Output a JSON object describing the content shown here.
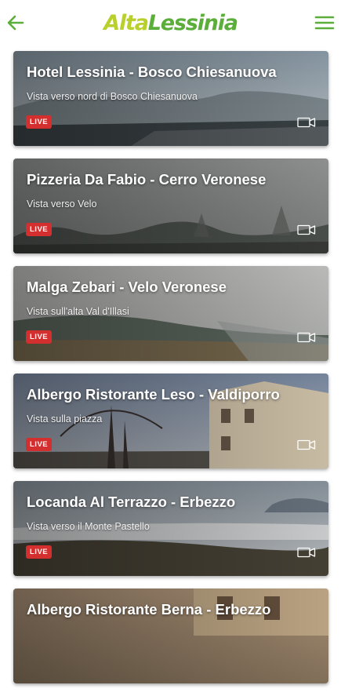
{
  "header": {
    "logo_part1": "Alta",
    "logo_part2": "Lessinia",
    "back_icon": "arrow-left-icon",
    "menu_icon": "hamburger-menu-icon",
    "accent": "#5cae3a"
  },
  "webcams": [
    {
      "title": "Hotel Lessinia - Bosco Chiesanuova",
      "subtitle": "Vista verso nord di Bosco Chiesanuova",
      "badge": "LIVE",
      "icon": "video-camera-icon"
    },
    {
      "title": "Pizzeria Da Fabio - Cerro Veronese",
      "subtitle": "Vista verso Velo",
      "badge": "LIVE",
      "icon": "video-camera-icon"
    },
    {
      "title": "Malga Zebari - Velo Veronese",
      "subtitle": "Vista sull'alta Val d'Illasi",
      "badge": "LIVE",
      "icon": "video-camera-icon"
    },
    {
      "title": "Albergo Ristorante Leso - Valdiporro",
      "subtitle": "Vista sulla piazza",
      "badge": "LIVE",
      "icon": "video-camera-icon"
    },
    {
      "title": "Locanda Al Terrazzo - Erbezzo",
      "subtitle": "Vista verso il Monte Pastello",
      "badge": "LIVE",
      "icon": "video-camera-icon"
    },
    {
      "title": "Albergo Ristorante Berna - Erbezzo",
      "subtitle": "",
      "badge": "",
      "icon": "video-camera-icon"
    }
  ],
  "colors": {
    "live_badge": "#d32f2f",
    "logo_light": "#b8cf2c",
    "logo_dark": "#5cae3a"
  }
}
